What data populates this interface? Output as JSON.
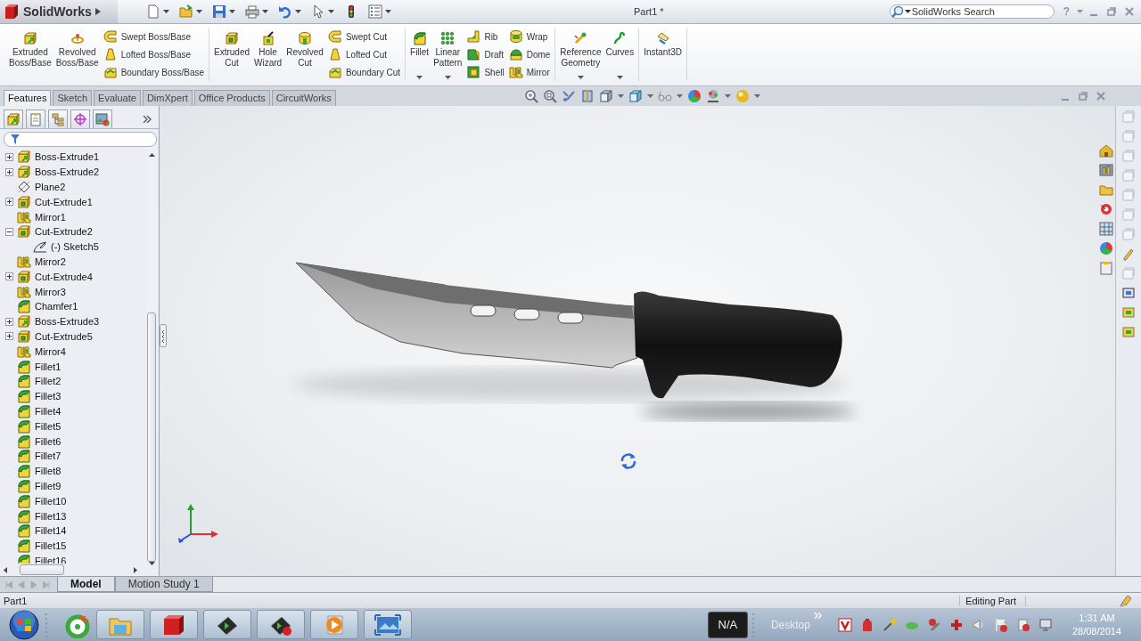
{
  "window": {
    "app_name": "SolidWorks",
    "title": "Part1 *",
    "search_placeholder": "SolidWorks Search",
    "help": "?"
  },
  "ribbon": [
    {
      "items": [
        {
          "kind": "large",
          "label": "Extruded\nBoss/Base",
          "dropdown": false
        },
        {
          "kind": "large",
          "label": "Revolved\nBoss/Base",
          "dropdown": false
        },
        {
          "kind": "stack",
          "entries": [
            "Swept Boss/Base",
            "Lofted Boss/Base",
            "Boundary Boss/Base"
          ]
        }
      ]
    },
    {
      "items": [
        {
          "kind": "large",
          "label": "Extruded\nCut",
          "dropdown": false
        },
        {
          "kind": "large",
          "label": "Hole\nWizard",
          "dropdown": false
        },
        {
          "kind": "large",
          "label": "Revolved\nCut",
          "dropdown": false
        },
        {
          "kind": "stack",
          "entries": [
            "Swept Cut",
            "Lofted Cut",
            "Boundary Cut"
          ]
        }
      ]
    },
    {
      "items": [
        {
          "kind": "large",
          "label": "Fillet",
          "dropdown": true
        },
        {
          "kind": "large",
          "label": "Linear\nPattern",
          "dropdown": true
        },
        {
          "kind": "stack",
          "entries": [
            "Rib",
            "Draft",
            "Shell"
          ]
        },
        {
          "kind": "stack",
          "entries": [
            "Wrap",
            "Dome",
            "Mirror"
          ]
        }
      ]
    },
    {
      "items": [
        {
          "kind": "large",
          "label": "Reference\nGeometry",
          "dropdown": true
        },
        {
          "kind": "large",
          "label": "Curves",
          "dropdown": true
        }
      ]
    },
    {
      "items": [
        {
          "kind": "large",
          "label": "Instant3D",
          "dropdown": false
        }
      ]
    }
  ],
  "command_tabs": [
    {
      "label": "Features",
      "selected": true
    },
    {
      "label": "Sketch",
      "selected": false
    },
    {
      "label": "Evaluate",
      "selected": false
    },
    {
      "label": "DimXpert",
      "selected": false
    },
    {
      "label": "Office Products",
      "selected": false
    },
    {
      "label": "CircuitWorks",
      "selected": false
    }
  ],
  "feature_tree": [
    {
      "kind": "boss",
      "label": "Boss-Extrude1",
      "expanded": false
    },
    {
      "kind": "boss",
      "label": "Boss-Extrude2",
      "expanded": false
    },
    {
      "kind": "plane",
      "label": "Plane2"
    },
    {
      "kind": "cut",
      "label": "Cut-Extrude1",
      "expanded": false
    },
    {
      "kind": "mirror",
      "label": "Mirror1"
    },
    {
      "kind": "cut",
      "label": "Cut-Extrude2",
      "expanded": true,
      "children": [
        {
          "kind": "sketch",
          "label": "(-) Sketch5"
        }
      ]
    },
    {
      "kind": "mirror",
      "label": "Mirror2"
    },
    {
      "kind": "cut",
      "label": "Cut-Extrude4",
      "expanded": false
    },
    {
      "kind": "mirror",
      "label": "Mirror3"
    },
    {
      "kind": "chamfer",
      "label": "Chamfer1"
    },
    {
      "kind": "boss",
      "label": "Boss-Extrude3",
      "expanded": false
    },
    {
      "kind": "cut",
      "label": "Cut-Extrude5",
      "expanded": false
    },
    {
      "kind": "mirror",
      "label": "Mirror4"
    },
    {
      "kind": "fillet",
      "label": "Fillet1"
    },
    {
      "kind": "fillet",
      "label": "Fillet2"
    },
    {
      "kind": "fillet",
      "label": "Fillet3"
    },
    {
      "kind": "fillet",
      "label": "Fillet4"
    },
    {
      "kind": "fillet",
      "label": "Fillet5"
    },
    {
      "kind": "fillet",
      "label": "Fillet6"
    },
    {
      "kind": "fillet",
      "label": "Fillet7"
    },
    {
      "kind": "fillet",
      "label": "Fillet8"
    },
    {
      "kind": "fillet",
      "label": "Fillet9"
    },
    {
      "kind": "fillet",
      "label": "Fillet10"
    },
    {
      "kind": "fillet",
      "label": "Fillet13"
    },
    {
      "kind": "fillet",
      "label": "Fillet14"
    },
    {
      "kind": "fillet",
      "label": "Fillet15"
    },
    {
      "kind": "fillet",
      "label": "Fillet16"
    }
  ],
  "model_tabs": [
    {
      "label": "Model",
      "selected": true
    },
    {
      "label": "Motion Study 1",
      "selected": false
    }
  ],
  "status_bar": {
    "document": "Part1",
    "mode": "Editing Part"
  },
  "taskbar": {
    "language": "N/A",
    "toolbar": "Desktop",
    "time": "1:31 AM",
    "date": "28/08/2014"
  }
}
